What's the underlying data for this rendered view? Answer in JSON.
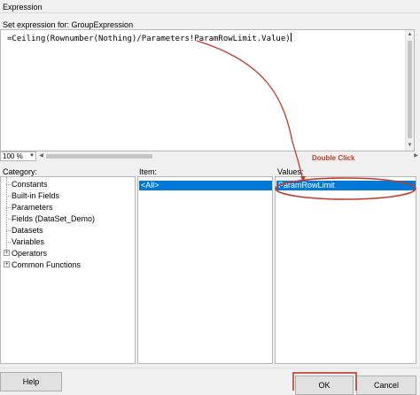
{
  "window": {
    "title": "Expression"
  },
  "editor": {
    "label": "Set expression for: GroupExpression",
    "code_prefix": "=Ceiling(Rownumber(Nothing)/Parameters!ParamRowLimit.Value)"
  },
  "zoom": {
    "value": "100 %"
  },
  "panels": {
    "category": {
      "label": "Category:",
      "items": [
        {
          "label": "Constants",
          "expandable": false
        },
        {
          "label": "Built-in Fields",
          "expandable": false
        },
        {
          "label": "Parameters",
          "expandable": false
        },
        {
          "label": "Fields (DataSet_Demo)",
          "expandable": false
        },
        {
          "label": "Datasets",
          "expandable": false
        },
        {
          "label": "Variables",
          "expandable": false
        },
        {
          "label": "Operators",
          "expandable": true
        },
        {
          "label": "Common Functions",
          "expandable": true
        }
      ]
    },
    "item": {
      "label": "Item:",
      "selected": "<All>"
    },
    "values": {
      "label": "Values:",
      "selected": "ParamRowLimit"
    }
  },
  "annotation": {
    "text": "Double Click",
    "color": "#c0392b"
  },
  "buttons": {
    "help": "Help",
    "ok": "OK",
    "cancel": "Cancel"
  },
  "colors": {
    "selection": "#0078d7",
    "annotation": "#c0392b"
  }
}
